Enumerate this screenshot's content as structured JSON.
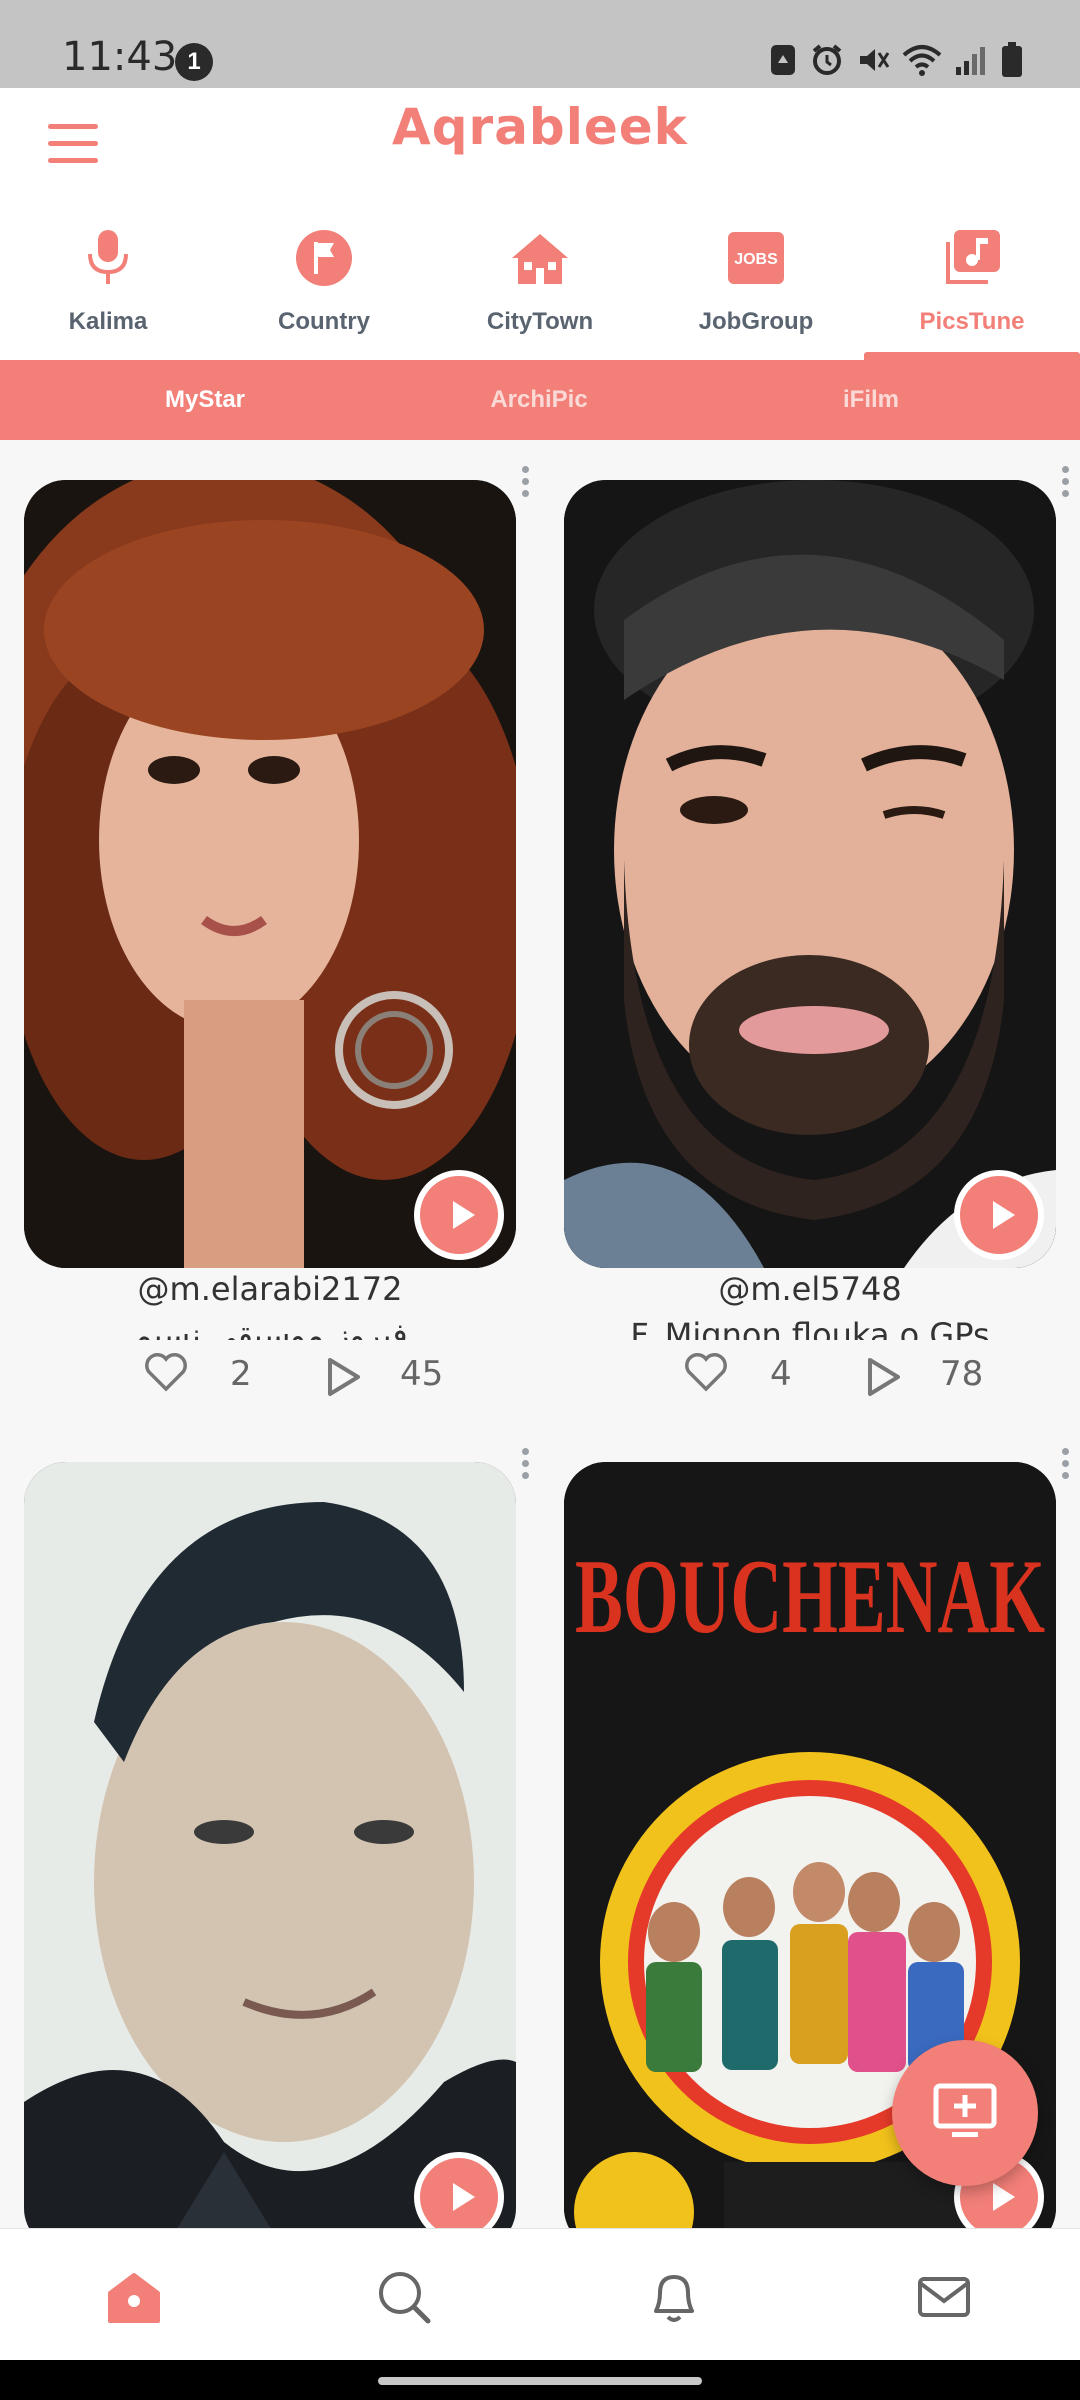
{
  "status_bar": {
    "time": "11:43",
    "notification_count": "1"
  },
  "header": {
    "app_title": "Aqrableek"
  },
  "categories": [
    {
      "label": "Kalima",
      "icon": "microphone-icon",
      "active": false
    },
    {
      "label": "Country",
      "icon": "flag-icon",
      "active": false
    },
    {
      "label": "CityTown",
      "icon": "city-icon",
      "active": false
    },
    {
      "label": "JobGroup",
      "icon": "jobs-icon",
      "icon_text": "JOBS",
      "active": false
    },
    {
      "label": "PicsTune",
      "icon": "music-icon",
      "active": true
    }
  ],
  "subtabs": [
    {
      "label": "MyStar",
      "active": true
    },
    {
      "label": "ArchiPic",
      "active": false
    },
    {
      "label": "iFilm",
      "active": false
    }
  ],
  "posts": [
    {
      "handle": "@m.elarabi2172",
      "caption": "فيروز موسيقى نسيم",
      "likes": "2",
      "plays": "45"
    },
    {
      "handle": "@m.el5748",
      "caption": "F_Mignon flouka o GPs",
      "likes": "4",
      "plays": "78"
    },
    {
      "handle": "",
      "caption": "",
      "likes": "",
      "plays": ""
    },
    {
      "handle": "",
      "caption": "",
      "likes": "",
      "plays": "",
      "cover_text": "BOUCHENAK"
    }
  ],
  "bottom_nav": [
    {
      "icon": "home-icon",
      "active": true
    },
    {
      "icon": "search-icon",
      "active": false
    },
    {
      "icon": "bell-icon",
      "active": false
    },
    {
      "icon": "mail-icon",
      "active": false
    }
  ],
  "colors": {
    "accent": "#f27f78",
    "inactive_label": "#5a6470"
  }
}
